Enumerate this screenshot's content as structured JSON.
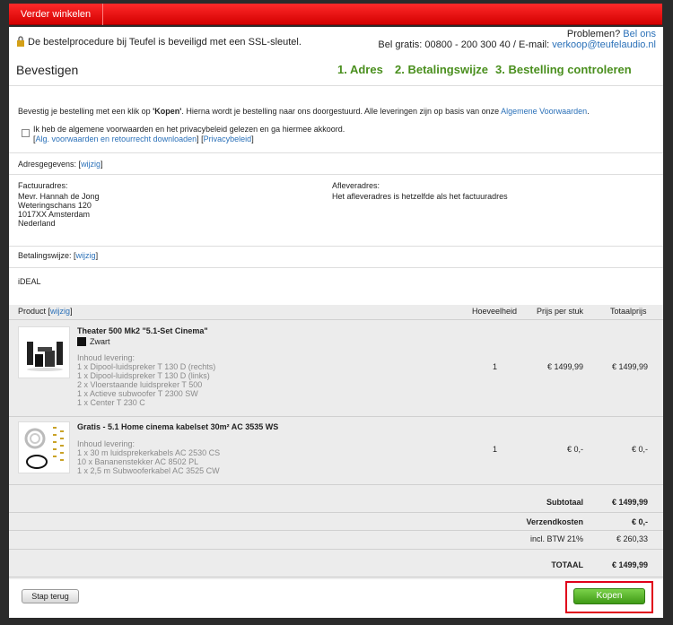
{
  "topbar": {
    "continue_shopping": "Verder winkelen"
  },
  "header": {
    "ssl_notice": "De bestelprocedure bij Teufel is beveiligd met een SSL-sleutel.",
    "problems_label": "Problemen?",
    "call_us": "Bel ons",
    "phone_line": "Bel gratis: 00800 - 200 300 40 / E-mail:",
    "email": "verkoop@teufelaudio.nl"
  },
  "steps": {
    "title": "Bevestigen",
    "items": [
      "1. Adres",
      "2. Betalingswijze",
      "3. Bestelling controleren"
    ]
  },
  "confirm": {
    "intro_prefix": "Bevestig je bestelling met een klik op",
    "intro_bold": "'Kopen'",
    "intro_suffix": ". Hierna wordt je bestelling naar ons doorgestuurd. Alle leveringen zijn op basis van onze",
    "terms_link": "Algemene Voorwaarden",
    "checkbox_label": "Ik heb de algemene voorwaarden en het privacybeleid gelezen en ga hiermee akkoord.",
    "download_link": "Alg. voorwaarden en retourrecht downloaden",
    "privacy_link": "Privacybeleid"
  },
  "address": {
    "label": "Adresgegevens:",
    "edit": "wijzig",
    "billing_title": "Factuuradres:",
    "billing_lines": [
      "Mevr. Hannah de Jong",
      "Weteringschans 120",
      "1017XX Amsterdam",
      "Nederland"
    ],
    "delivery_title": "Afleveradres:",
    "delivery_text": "Het afleveradres is hetzelfde als het factuuradres"
  },
  "payment": {
    "label": "Betalingswijze:",
    "edit": "wijzig",
    "method": "iDEAL"
  },
  "table": {
    "headers": {
      "product": "Product",
      "edit": "wijzig",
      "qty": "Hoeveelheid",
      "unit_price": "Prijs per stuk",
      "total": "Totaalprijs"
    },
    "products": [
      {
        "name": "Theater 500 Mk2 \"5.1-Set Cinema\"",
        "color": "Zwart",
        "contents_label": "Inhoud levering:",
        "contents": [
          "1 x Dipool-luidspreker T 130 D (rechts)",
          "1 x Dipool-luidspreker T 130 D (links)",
          "2 x Vloerstaande luidspreker T 500",
          "1 x Actieve subwoofer T 2300 SW",
          "1 x Center T 230 C"
        ],
        "qty": "1",
        "unit_price": "€ 1499,99",
        "total": "€ 1499,99"
      },
      {
        "name": "Gratis - 5.1 Home cinema kabelset 30m² AC 3535 WS",
        "contents_label": "Inhoud levering:",
        "contents": [
          "1 x 30 m luidsprekerkabels AC 2530 CS",
          "10 x Bananenstekker AC 8502 PL",
          "1 x 2,5 m Subwooferkabel AC 3525 CW"
        ],
        "qty": "1",
        "unit_price": "€ 0,-",
        "total": "€ 0,-"
      }
    ]
  },
  "summary": {
    "subtotal_label": "Subtotaal",
    "subtotal": "€ 1499,99",
    "shipping_label": "Verzendkosten",
    "shipping": "€ 0,-",
    "vat_label": "incl. BTW 21%",
    "vat": "€ 260,33",
    "total_label": "TOTAAL",
    "total": "€ 1499,99"
  },
  "buttons": {
    "back": "Stap terug",
    "buy": "Kopen"
  },
  "colors": {
    "brand_red": "#e60000",
    "step_green": "#4a8f1e",
    "link_blue": "#2a70b8",
    "buy_green": "#3f9a16"
  }
}
